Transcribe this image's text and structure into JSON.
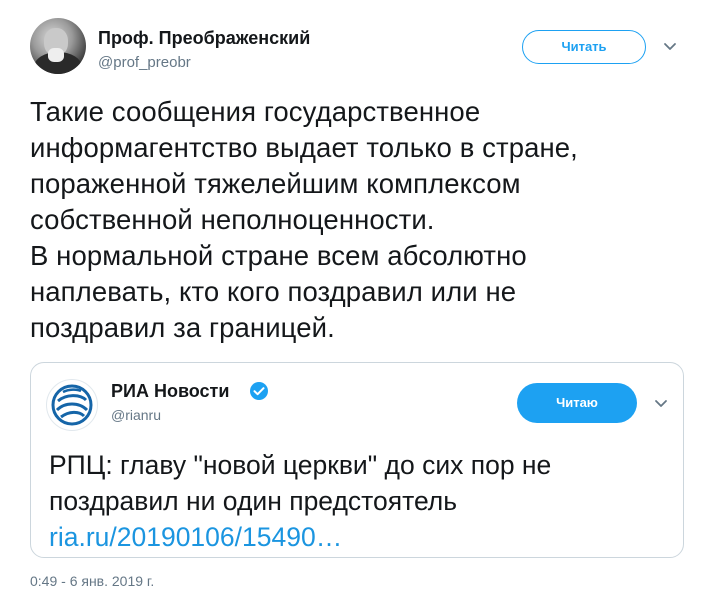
{
  "tweet": {
    "author_name": "Проф. Преображенский",
    "author_handle": "@prof_preobr",
    "follow_label": "Читать",
    "text_lines": [
      "Такие сообщения государственное",
      "информагентство выдает только в стране,",
      "пораженной тяжелейшим комплексом",
      "собственной неполноценности.",
      "В нормальной стране всем абсолютно",
      "наплевать, кто кого поздравил или не",
      "поздравил за границей."
    ],
    "timestamp": "0:49 - 6 янв. 2019 г."
  },
  "quoted": {
    "author_name": "РИА Новости",
    "author_handle": "@rianru",
    "follow_label": "Читаю",
    "text_lines": [
      "РПЦ: главу \"новой церкви\" до сих пор не",
      "поздравил ни один предстоятель"
    ],
    "link": "ria.ru/20190106/15490…"
  },
  "icons": {
    "caret": "chevron-down-icon",
    "verified": "verified-badge-icon"
  },
  "colors": {
    "accent": "#1da1f2",
    "link": "#1b95e0",
    "muted": "#657786",
    "text": "#14171a",
    "border": "#ccd6dd"
  }
}
